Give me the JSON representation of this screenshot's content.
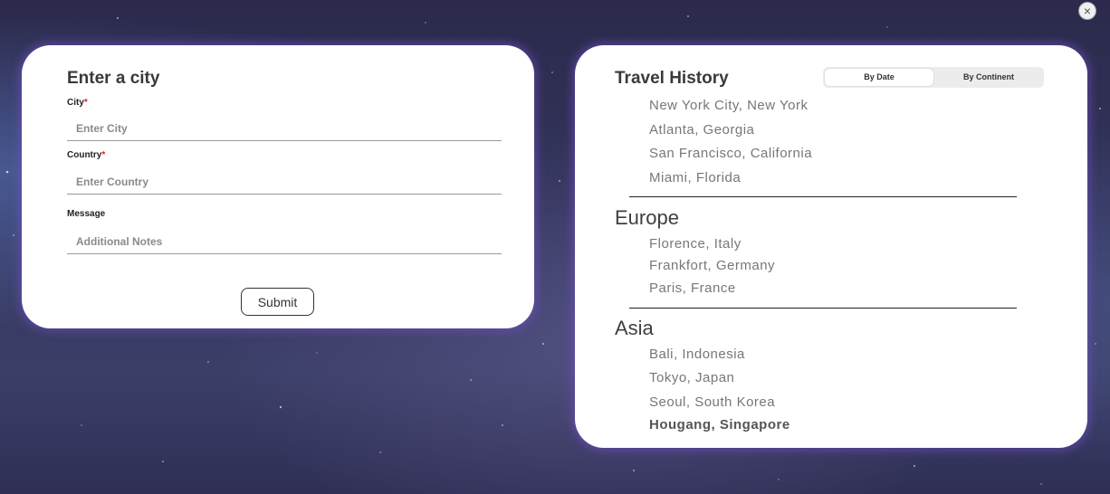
{
  "close": {
    "glyph": "×"
  },
  "form": {
    "title": "Enter a city",
    "city": {
      "label": "City",
      "required": "*",
      "placeholder": "Enter City"
    },
    "country": {
      "label": "Country",
      "required": "*",
      "placeholder": "Enter Country"
    },
    "message": {
      "label": "Message",
      "placeholder": "Additional Notes"
    },
    "submit_label": "Submit"
  },
  "history": {
    "title": "Travel History",
    "tabs": [
      {
        "label": "By Date",
        "active": true
      },
      {
        "label": "By Continent",
        "active": false
      }
    ],
    "groups": [
      {
        "name": "",
        "cities": [
          "New York City, New York",
          "Atlanta, Georgia",
          "San Francisco, California",
          "Miami, Florida"
        ]
      },
      {
        "name": "Europe",
        "cities": [
          "Florence, Italy",
          "Frankfort, Germany",
          "Paris, France"
        ]
      },
      {
        "name": "Asia",
        "cities": [
          "Bali, Indonesia",
          "Tokyo, Japan",
          "Seoul, South Korea",
          "Hougang, Singapore"
        ]
      }
    ]
  }
}
